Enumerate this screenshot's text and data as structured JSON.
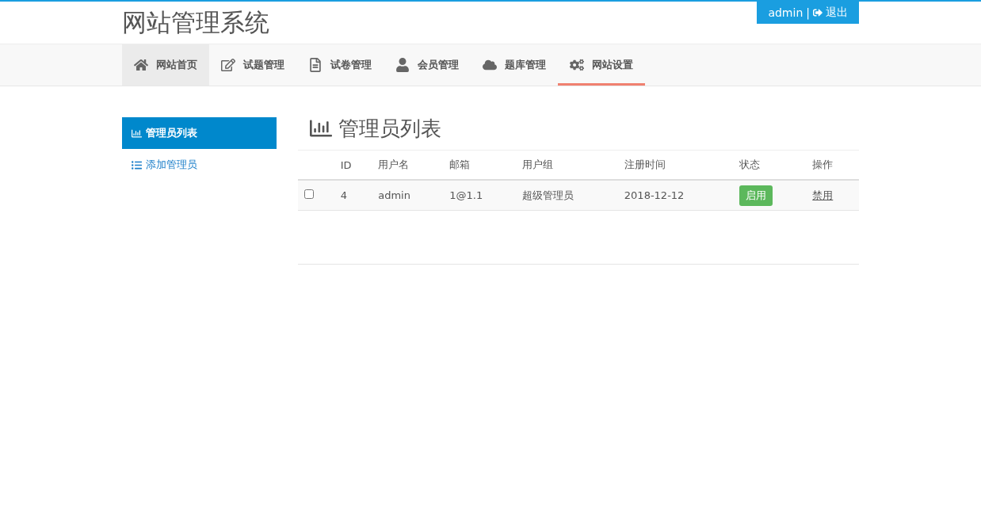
{
  "header": {
    "title": "网站管理系统",
    "user": "admin",
    "separator": "|",
    "logout": "退出"
  },
  "nav": [
    {
      "label": "网站首页",
      "selected": false,
      "hovered": true
    },
    {
      "label": "试题管理",
      "selected": false,
      "hovered": false
    },
    {
      "label": "试卷管理",
      "selected": false,
      "hovered": false
    },
    {
      "label": "会员管理",
      "selected": false,
      "hovered": false
    },
    {
      "label": "题库管理",
      "selected": false,
      "hovered": false
    },
    {
      "label": "网站设置",
      "selected": true,
      "hovered": false
    }
  ],
  "sidebar": {
    "items": [
      {
        "label": "管理员列表",
        "selected": true
      },
      {
        "label": "添加管理员",
        "selected": false
      }
    ]
  },
  "main": {
    "heading": "管理员列表",
    "table": {
      "columns": [
        "ID",
        "用户名",
        "邮箱",
        "用户组",
        "注册时间",
        "状态",
        "操作"
      ],
      "rows": [
        {
          "checked": false,
          "cells": [
            "4",
            "admin",
            "1@1.1",
            "超级管理员",
            "2018-12-12"
          ],
          "status": "启用",
          "action": "禁用"
        }
      ]
    }
  }
}
